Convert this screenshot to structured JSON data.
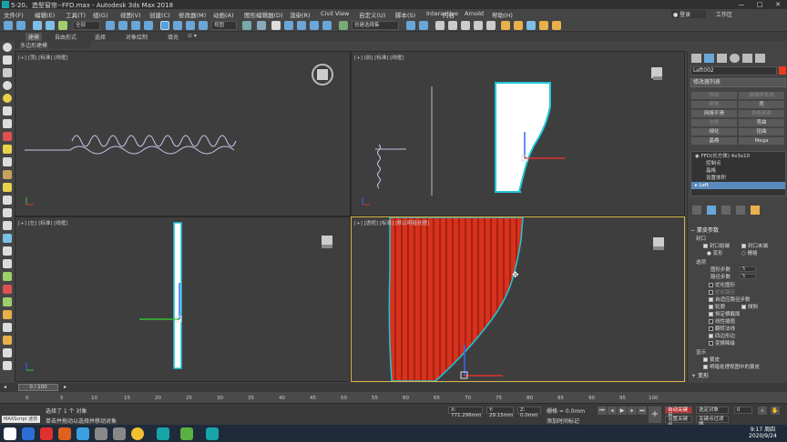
{
  "window": {
    "title": "5-20、造型窗帘--FFD.max - Autodesk 3ds Max 2018",
    "min": "—",
    "max": "□",
    "close": "✕"
  },
  "menu": {
    "items": [
      "文件(F)",
      "编辑(E)",
      "工具(T)",
      "组(G)",
      "视图(V)",
      "创建(C)",
      "修改器(M)",
      "动画(A)",
      "图形编辑器(D)",
      "渲染(R)",
      "Civil View",
      "自定义(U)",
      "脚本(S)",
      "Interactive",
      "内容",
      "Arnold",
      "帮助(H)"
    ],
    "login": "登录",
    "workspace": "工作区"
  },
  "toolbar": {
    "selection_set": "全部",
    "view": "视图",
    "named_selection": "创建选择集"
  },
  "ribbon": {
    "tabs": [
      "建模",
      "自由形式",
      "选择",
      "对象绘制",
      "填充"
    ],
    "active": "建模",
    "sub": "多边形建模"
  },
  "viewports": {
    "top": "[+] [顶] [标准] [线框]",
    "front": "[+] [前] [标准] [线框]",
    "left": "[+] [左] [标准] [线框]",
    "persp": "[+] [透视] [标准] [默认明暗处理]"
  },
  "command_panel": {
    "object_name": "Left002",
    "modifier_list": "修改器列表",
    "buttons": [
      [
        "挤出",
        "编辑样条线"
      ],
      [
        "倒角",
        "壳"
      ],
      [
        "网格平滑",
        "倒角剖面"
      ],
      [
        "车削",
        "弯曲"
      ],
      [
        "细化",
        "扭曲"
      ],
      [
        "晶格",
        "Mega"
      ]
    ],
    "stack": [
      "FFD(长方体) 4x3x10",
      "控制点",
      "晶格",
      "设置体积",
      "Left"
    ],
    "rollout_title": "蒙皮参数",
    "cap_title": "封口",
    "cap_start": "封口始端",
    "cap_end": "封口末端",
    "morph": "变形",
    "grid": "栅格",
    "options_title": "选项",
    "shape_steps_label": "图形步数",
    "shape_steps": "5",
    "path_steps_label": "路径步数",
    "path_steps": "5",
    "options": [
      "优化图形",
      "优化路径",
      "自适应路径步数",
      "轮廓",
      "倾斜",
      "恒定横截面",
      "线性插值",
      "翻转法线",
      "四边形边",
      "变换降级"
    ],
    "display_title": "显示",
    "display_skin": "蒙皮",
    "display_skin_shaded": "明暗处理视图中的蒙皮",
    "deform": "变形"
  },
  "timeline": {
    "frame": "0 / 100",
    "ticks": [
      "0",
      "5",
      "10",
      "15",
      "20",
      "25",
      "30",
      "35",
      "40",
      "45",
      "50",
      "55",
      "60",
      "65",
      "70",
      "75",
      "80",
      "85",
      "90",
      "95",
      "100"
    ]
  },
  "status": {
    "maxscript": "MAXScript 迷你",
    "selected": "选择了 1 个 对象",
    "hint": "单击并拖动以选择并移动对象",
    "x": "X: 771.296mm",
    "y": "Y: 29.15mm",
    "z": "Z: 0.0mm",
    "grid": "栅格 = 0.0mm",
    "add_tag": "添加时间标记",
    "auto_key": "自动关键点",
    "selected_obj": "选定对象",
    "set_key": "设置关键点",
    "key_filter": "关键点过滤器...",
    "frame_num": "0"
  },
  "taskbar": {
    "time": "9:17 周四",
    "date": "2020/9/24"
  },
  "colors": {
    "accent": "#5b8bbd",
    "curtain": "#d6321e",
    "active_border": "#d7b64b"
  }
}
